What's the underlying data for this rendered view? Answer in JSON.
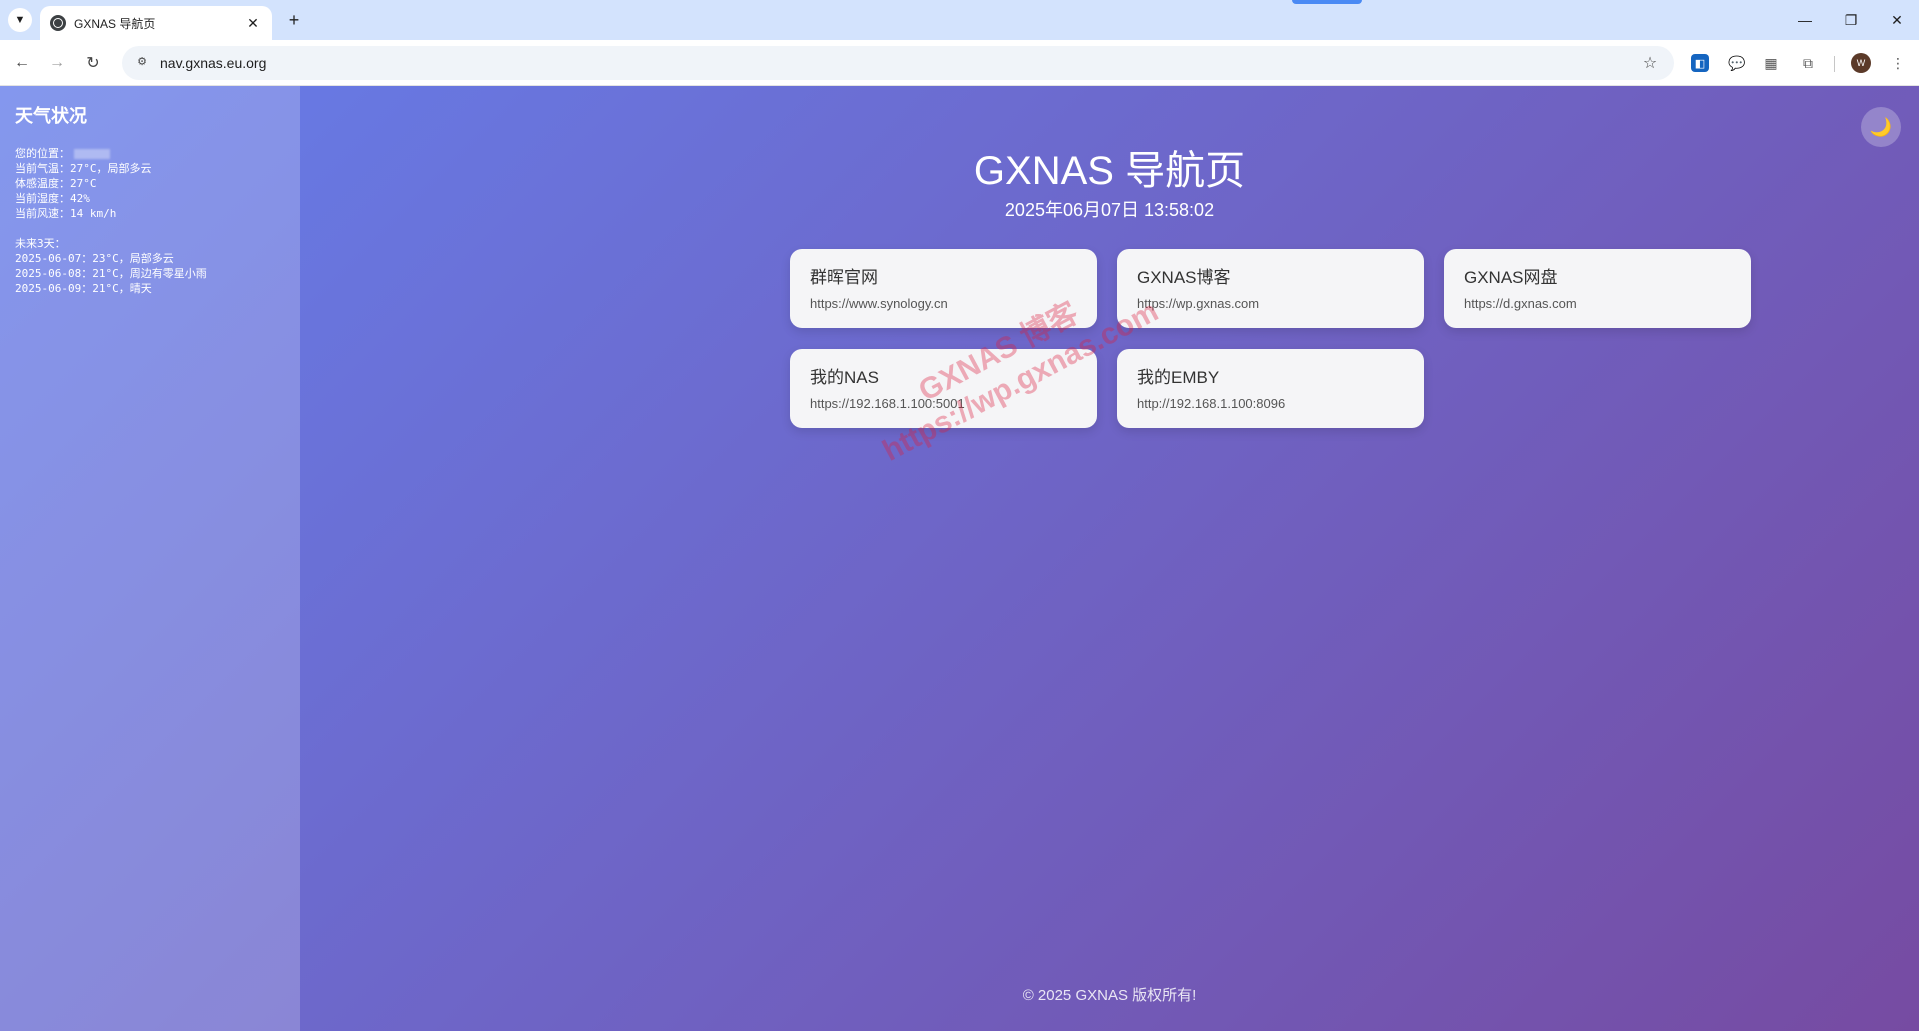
{
  "browser": {
    "tab_title": "GXNAS 导航页",
    "url": "nav.gxnas.eu.org",
    "avatar_letter": "W",
    "icons": {
      "tab_search": "chevron-down-icon",
      "tab_favicon": "globe-icon",
      "tab_close": "close-icon",
      "new_tab": "plus-icon",
      "back": "arrow-left-icon",
      "forward": "arrow-right-icon",
      "reload": "reload-icon",
      "site_info": "tune-icon",
      "bookmark": "star-icon",
      "minimize": "minimize-icon",
      "restore": "restore-icon",
      "close_window": "close-icon",
      "menu": "kebab-menu-icon"
    }
  },
  "weather": {
    "title": "天气状况",
    "location_label": "您的位置：",
    "current_temp": "当前气温：27°C，局部多云",
    "feels_like": "体感温度：27°C",
    "humidity": "当前湿度：42%",
    "wind": "当前风速：14 km/h",
    "forecast_title": "未来3天：",
    "forecast": [
      "2025-06-07：23°C，局部多云",
      "2025-06-08：21°C，周边有零星小雨",
      "2025-06-09：21°C，晴天"
    ]
  },
  "header": {
    "title": "GXNAS 导航页",
    "datetime": "2025年06月07日 13:58:02"
  },
  "links": [
    {
      "name": "群晖官网",
      "url": "https://www.synology.cn"
    },
    {
      "name": "GXNAS博客",
      "url": "https://wp.gxnas.com"
    },
    {
      "name": "GXNAS网盘",
      "url": "https://d.gxnas.com"
    },
    {
      "name": "我的NAS",
      "url": "https://192.168.1.100:5001"
    },
    {
      "name": "我的EMBY",
      "url": "http://192.168.1.100:8096"
    }
  ],
  "watermark": {
    "line1": "GXNAS 博客",
    "line2": "https://wp.gxnas.com"
  },
  "footer": "© 2025 GXNAS 版权所有!",
  "theme_toggle_icon": "moon-icon",
  "colors": {
    "gradient_start": "#667eea",
    "gradient_end": "#764ba2",
    "card_bg": "#f5f5f7"
  }
}
